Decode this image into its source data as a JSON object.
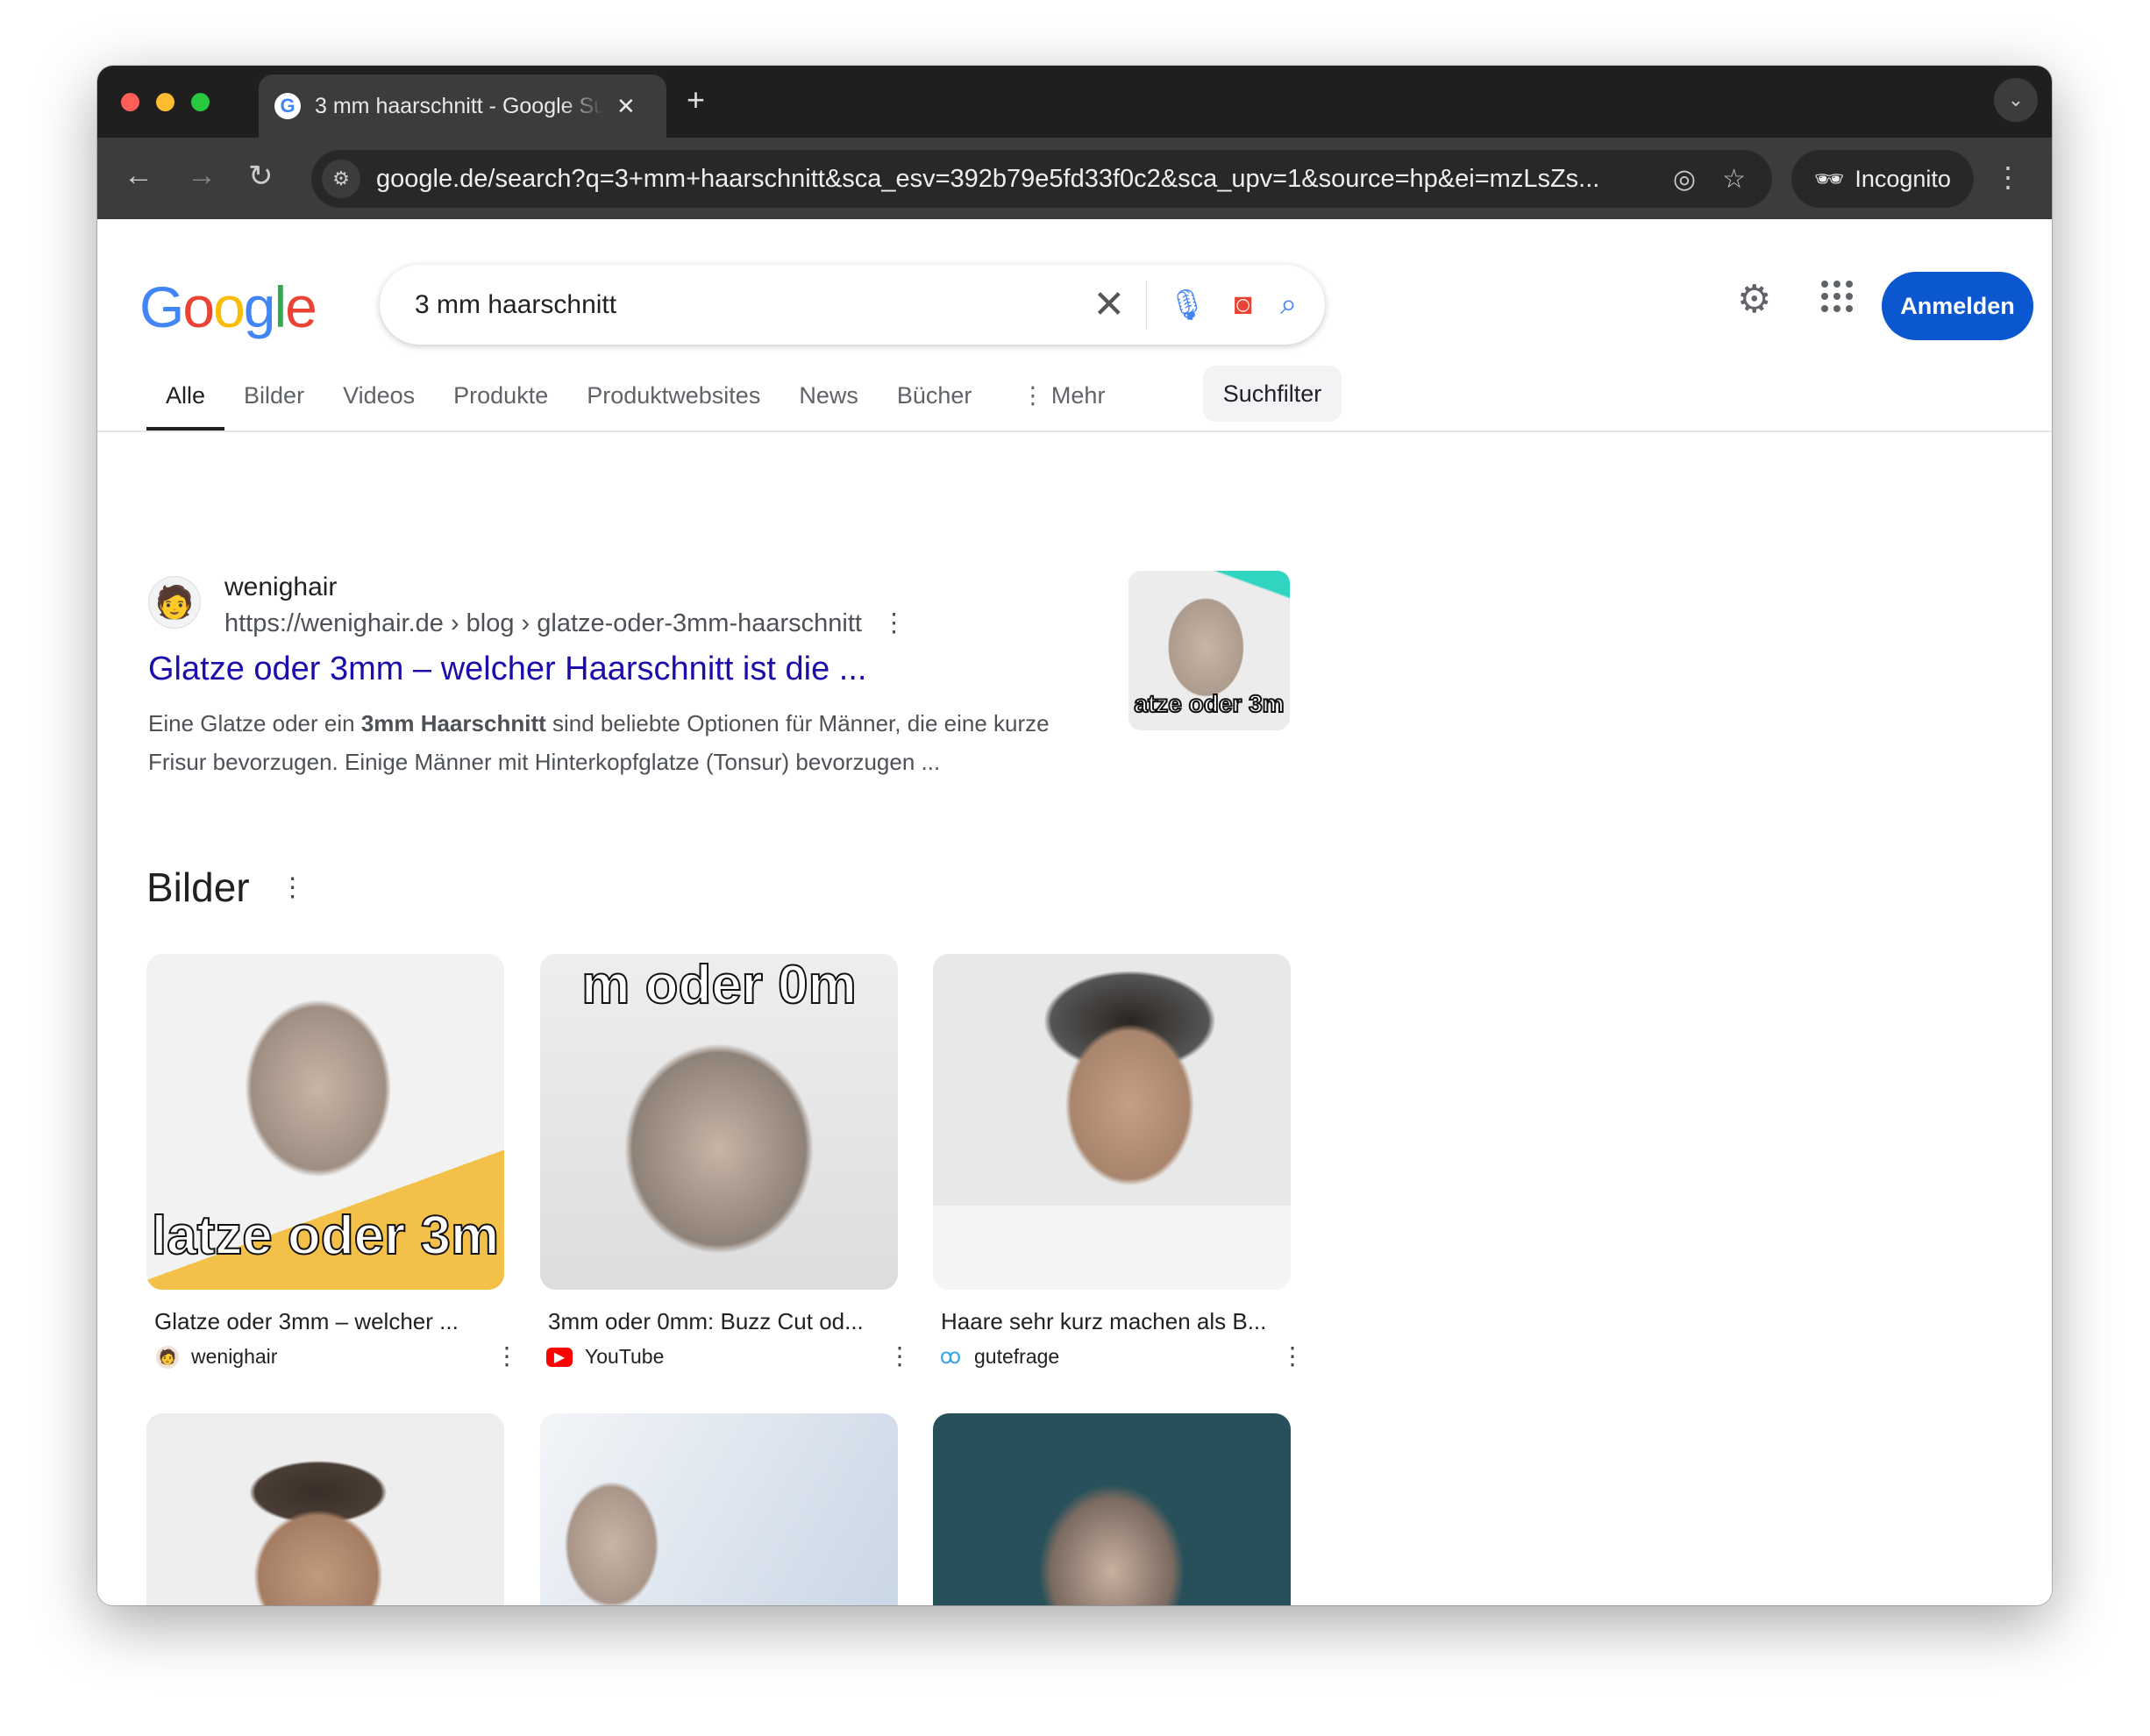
{
  "browser": {
    "tab_title": "3 mm haarschnitt - Google Suche",
    "url": "google.de/search?q=3+mm+haarschnitt&sca_esv=392b79e5fd33f0c2&sca_upv=1&source=hp&ei=mzLsZs...",
    "incognito_label": "Incognito",
    "colors": {
      "close": "#ff5f57",
      "minimize": "#febc2e",
      "zoom": "#28c840"
    }
  },
  "header": {
    "logo": "Google",
    "query": "3 mm haarschnitt",
    "signin_label": "Anmelden",
    "accent": "#0b57d0"
  },
  "tabs": [
    {
      "label": "Alle",
      "active": true
    },
    {
      "label": "Bilder"
    },
    {
      "label": "Videos"
    },
    {
      "label": "Produkte"
    },
    {
      "label": "Produktwebsites"
    },
    {
      "label": "News"
    },
    {
      "label": "Bücher"
    },
    {
      "label": "Mehr"
    }
  ],
  "filter_label": "Suchfilter",
  "result": {
    "site": "wenighair",
    "breadcrumb": "https://wenighair.de › blog › glatze-oder-3mm-haarschnitt",
    "title": "Glatze oder 3mm – welcher Haarschnitt ist die ...",
    "snippet_pre": "Eine Glatze oder ein ",
    "snippet_bold": "3mm Haarschnitt",
    "snippet_post": " sind beliebte Optionen für Männer, die eine kurze Frisur bevorzugen. Einige Männer mit Hinterkopfglatze (Tonsur) bevorzugen ...",
    "thumb_caption": "atze oder 3m"
  },
  "images": {
    "heading": "Bilder",
    "items": [
      {
        "caption": "Glatze oder 3mm – welcher ...",
        "source": "wenighair",
        "overlay": "latze oder 3m"
      },
      {
        "caption": "3mm oder 0mm: Buzz Cut od...",
        "source": "YouTube",
        "overlay": "m oder 0m"
      },
      {
        "caption": "Haare sehr kurz machen als B...",
        "source": "gutefrage"
      }
    ]
  }
}
